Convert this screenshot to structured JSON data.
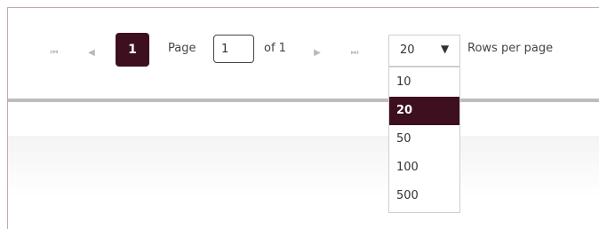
{
  "pager": {
    "first_icon": "first-page-icon",
    "prev_icon": "previous-page-icon",
    "next_icon": "next-page-icon",
    "last_icon": "last-page-icon",
    "current_page": "1",
    "page_label": "Page",
    "page_input_value": "1",
    "of_label": "of 1",
    "rows_select_value": "20",
    "rows_label": "Rows per page",
    "accent_color": "#3d0f1f"
  },
  "rows_menu": {
    "options": [
      "10",
      "20",
      "50",
      "100",
      "500"
    ],
    "selected": "20"
  }
}
